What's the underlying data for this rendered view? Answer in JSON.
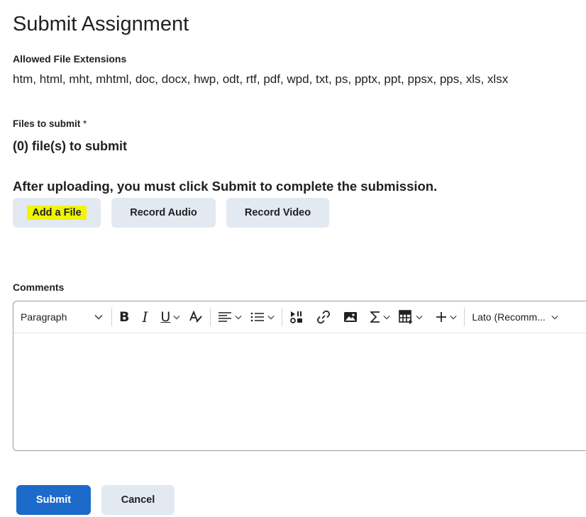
{
  "page": {
    "title": "Submit Assignment",
    "allowed_label": "Allowed File Extensions",
    "allowed_extensions": "htm, html, mht, mhtml, doc, docx, hwp, odt, rtf, pdf, wpd, txt, ps, pptx, ppt, ppsx, pps, xls, xlsx",
    "files_label": "Files to submit",
    "required_marker": "*",
    "files_count": "(0) file(s) to submit",
    "notice": "After uploading, you must click Submit to complete the submission."
  },
  "upload_buttons": {
    "add_file": "Add a File",
    "record_audio": "Record Audio",
    "record_video": "Record Video"
  },
  "comments": {
    "label": "Comments",
    "toolbar": {
      "block_format": "Paragraph",
      "font_family": "Lato (Recomm..."
    }
  },
  "footer": {
    "submit": "Submit",
    "cancel": "Cancel"
  },
  "colors": {
    "primary": "#1c6ac9",
    "secondary_button": "#e3e9f1",
    "highlight": "#f0f500"
  }
}
